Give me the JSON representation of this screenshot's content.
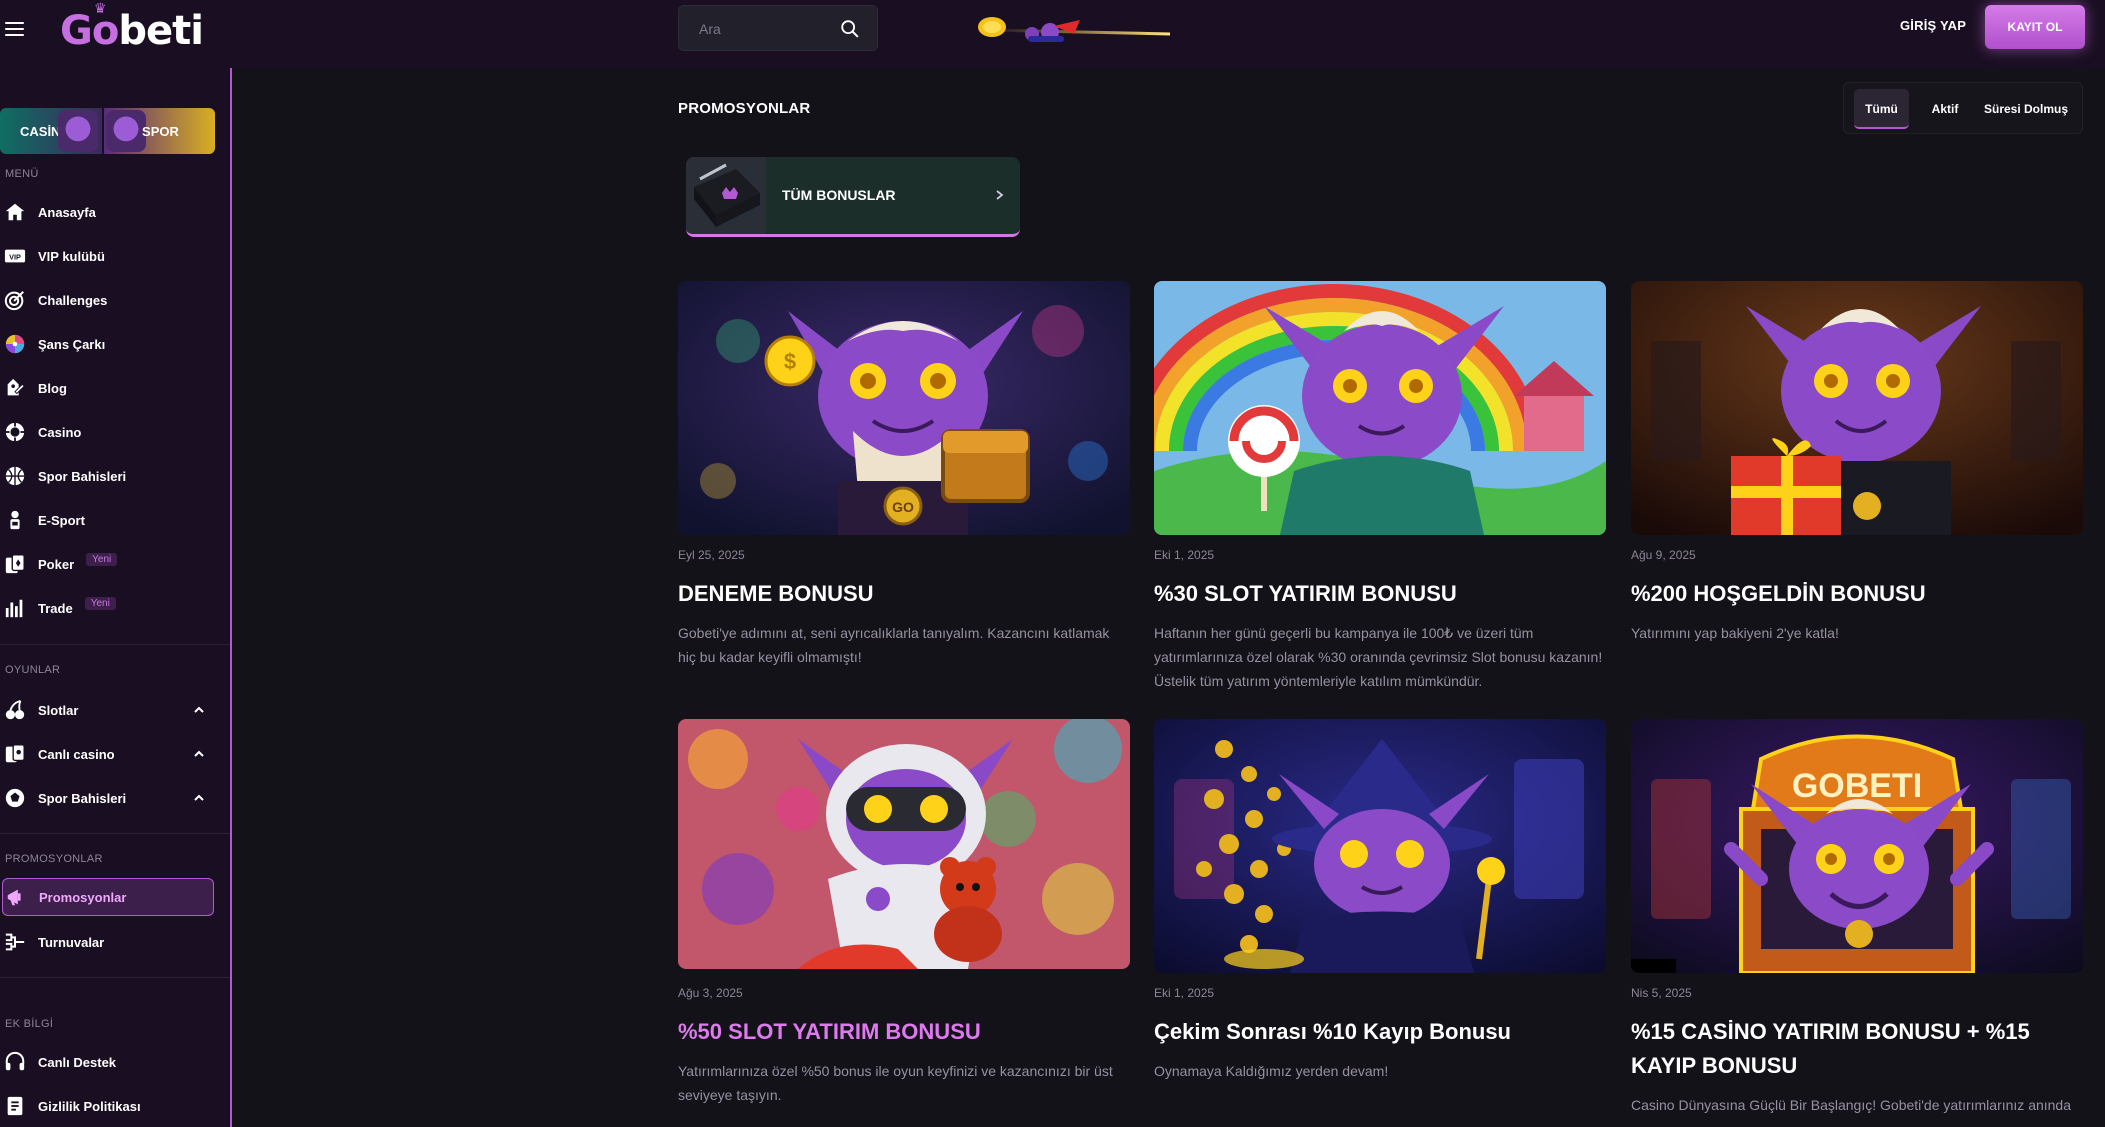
{
  "header": {
    "brand": "Gobeti",
    "search_placeholder": "Ara",
    "login_label": "GİRİŞ YAP",
    "register_label": "KAYIT OL"
  },
  "sidebar": {
    "quick_casino": "CASİNO",
    "quick_spor": "SPOR",
    "menu_title": "MENÜ",
    "menu_items": [
      {
        "label": "Anasayfa",
        "icon": "home-icon"
      },
      {
        "label": "VIP kulübü",
        "icon": "vip-icon"
      },
      {
        "label": "Challenges",
        "icon": "target-icon"
      },
      {
        "label": "Şans Çarkı",
        "icon": "wheel-icon"
      },
      {
        "label": "Blog",
        "icon": "blog-icon"
      },
      {
        "label": "Casino",
        "icon": "casino-chip-icon"
      },
      {
        "label": "Spor Bahisleri",
        "icon": "basketball-icon"
      },
      {
        "label": "E-Sport",
        "icon": "esport-icon"
      },
      {
        "label": "Poker",
        "icon": "cards-icon",
        "badge": "Yeni"
      },
      {
        "label": "Trade",
        "icon": "chart-icon",
        "badge": "Yeni"
      }
    ],
    "games_title": "OYUNLAR",
    "games_items": [
      {
        "label": "Slotlar",
        "icon": "cherry-icon"
      },
      {
        "label": "Canlı casino",
        "icon": "live-casino-icon"
      },
      {
        "label": "Spor Bahisleri",
        "icon": "sports-icon"
      }
    ],
    "promo_title": "PROMOSYONLAR",
    "promo_items": [
      {
        "label": "Promosyonlar",
        "icon": "megaphone-icon"
      },
      {
        "label": "Turnuvalar",
        "icon": "bracket-icon"
      }
    ],
    "extra_title": "EK BİLGİ",
    "extra_items": [
      {
        "label": "Canlı Destek",
        "icon": "headset-icon"
      },
      {
        "label": "Gizlilik Politikası",
        "icon": "document-icon"
      }
    ]
  },
  "main": {
    "title": "PROMOSYONLAR",
    "tabs": [
      {
        "label": "Tümü",
        "active": true
      },
      {
        "label": "Aktif",
        "active": false
      },
      {
        "label": "Süresi Dolmuş",
        "active": false
      }
    ],
    "all_bonuses_label": "TÜM BONUSLAR",
    "cards": [
      {
        "date": "Eyl 25, 2025",
        "title": "DENEME BONUSU",
        "desc": "Gobeti'ye adımını at, seni ayrıcalıklarla tanıyalım. Kazancını katlamak hiç bu kadar keyifli olmamıştı!",
        "accent": "#ffffff"
      },
      {
        "date": "Eki 1, 2025",
        "title": "%30 SLOT YATIRIM BONUSU",
        "desc": "Haftanın her günü geçerli bu kampanya ile 100₺ ve üzeri tüm yatırımlarınıza özel olarak %30 oranında çevrimsiz Slot bonusu kazanın! Üstelik tüm yatırım yöntemleriyle katılım mümkündür.",
        "accent": "#ffffff"
      },
      {
        "date": "Ağu 9, 2025",
        "title": "%200 HOŞGELDİN BONUSU",
        "desc": "Yatırımını yap bakiyeni 2'ye katla!",
        "accent": "#ffffff"
      },
      {
        "date": "Ağu 3, 2025",
        "title": "%50 SLOT YATIRIM BONUSU",
        "desc": "Yatırımlarınıza özel %50 bonus ile oyun keyfinizi ve kazancınızı bir üst seviyeye taşıyın.",
        "accent": "#de79ef"
      },
      {
        "date": "Eki 1, 2025",
        "title": "Çekim Sonrası %10 Kayıp Bonusu",
        "desc": "Oynamaya Kaldığımız yerden devam!",
        "accent": "#ffffff"
      },
      {
        "date": "Nis 5, 2025",
        "title": "%15 CASİNO YATIRIM BONUSU + %15 KAYIP BONUSU",
        "desc": "Casino Dünyasına Güçlü Bir Başlangıç! Gobeti'de yatırımlarınız anında",
        "accent": "#ffffff"
      }
    ],
    "card5_sign": "GOBETI",
    "medallion": "GO"
  },
  "colors": {
    "accent": "#c56fe0",
    "background": "#141219",
    "sidebar": "#1a0f22"
  }
}
